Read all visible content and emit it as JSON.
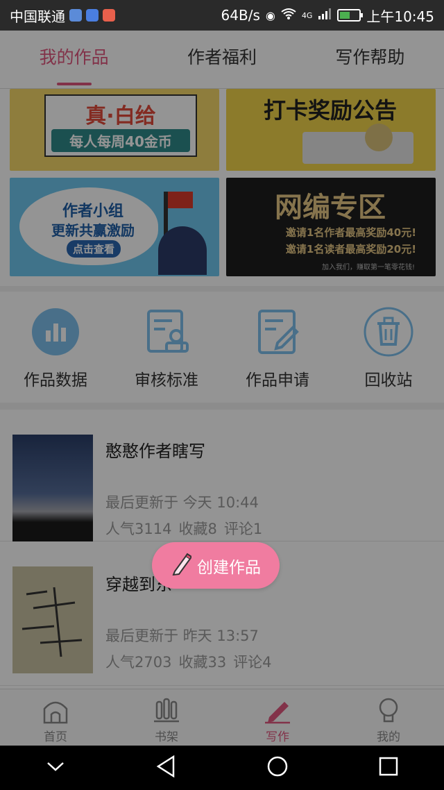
{
  "status_bar": {
    "carrier": "中国联通",
    "net_speed": "64B/s",
    "signal_type": "4G",
    "time": "上午10:45"
  },
  "top_tabs": [
    {
      "label": "我的作品",
      "active": true
    },
    {
      "label": "作者福利",
      "active": false
    },
    {
      "label": "写作帮助",
      "active": false
    }
  ],
  "banners": {
    "b1": {
      "line1": "真·白给",
      "line2": "每人每周40金币"
    },
    "b2": {
      "line1": "打卡奖励公告"
    },
    "b3": {
      "line1": "作者小组",
      "line2": "更新共赢激励",
      "button": "点击查看"
    },
    "b4": {
      "line1": "网编专区",
      "line2": "邀请1名作者最高奖励40元!",
      "line3": "邀请1名读者最高奖励20元!",
      "line4": "加入我们，赚取第一笔零花钱!"
    }
  },
  "tools": [
    {
      "label": "作品数据",
      "icon": "bar-chart-icon"
    },
    {
      "label": "审核标准",
      "icon": "review-icon"
    },
    {
      "label": "作品申请",
      "icon": "edit-doc-icon"
    },
    {
      "label": "回收站",
      "icon": "trash-icon"
    }
  ],
  "works": [
    {
      "title": "憨憨作者瞎写",
      "updated": "最后更新于 今天 10:44",
      "popularity": "人气3114",
      "favorites": "收藏8",
      "comments": "评论1"
    },
    {
      "title": "穿越到东",
      "updated": "最后更新于 昨天 13:57",
      "popularity": "人气2703",
      "favorites": "收藏33",
      "comments": "评论4"
    }
  ],
  "create_button": {
    "label": "创建作品"
  },
  "bottom_nav": [
    {
      "label": "首页",
      "active": false
    },
    {
      "label": "书架",
      "active": false
    },
    {
      "label": "写作",
      "active": true
    },
    {
      "label": "我的",
      "active": false
    }
  ],
  "colors": {
    "accent": "#e0567f",
    "create_button": "#f07ca0"
  }
}
